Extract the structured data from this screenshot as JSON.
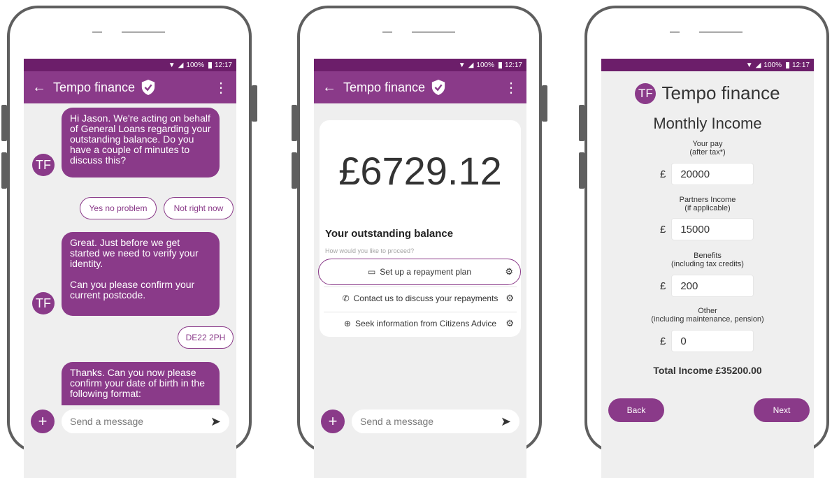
{
  "status": {
    "battery": "100%",
    "time": "12:17"
  },
  "phone1": {
    "app_title": "Tempo finance",
    "avatar_initials": "TF",
    "messages": [
      "Hi Jason. We're acting on behalf of General Loans regarding your outstanding balance. Do you have a couple of minutes to discuss this?",
      "Great. Just before we get started we need to verify your identity.\n\nCan you please confirm your current postcode.",
      "Thanks. Can you now please confirm your date of birth in the following format:"
    ],
    "quick_replies": [
      "Yes no problem",
      "Not right now"
    ],
    "user_reply": "DE22 2PH",
    "composer_placeholder": "Send a message"
  },
  "phone2": {
    "app_title": "Tempo finance",
    "amount": "£6729.12",
    "balance_label": "Your outstanding balance",
    "proceed_prompt": "How would you like to proceed?",
    "options": [
      {
        "label": "Set up a repayment plan",
        "icon": "card-icon"
      },
      {
        "label": "Contact us to discuss your repayments",
        "icon": "phone-icon"
      },
      {
        "label": "Seek information from Citizens Advice",
        "icon": "globe-icon"
      }
    ],
    "composer_placeholder": "Send a message"
  },
  "phone3": {
    "logo_initials": "TF",
    "brand": "Tempo finance",
    "form_title": "Monthly Income",
    "currency": "£",
    "fields": [
      {
        "label": "Your pay",
        "sublabel": "(after tax*)",
        "value": "20000"
      },
      {
        "label": "Partners Income",
        "sublabel": "(if applicable)",
        "value": "15000"
      },
      {
        "label": "Benefits",
        "sublabel": "(including tax credits)",
        "value": "200"
      },
      {
        "label": "Other",
        "sublabel": "(including maintenance, pension)",
        "value": "0"
      }
    ],
    "total": "Total Income £35200.00",
    "back_label": "Back",
    "next_label": "Next"
  },
  "colors": {
    "purple": "#8a3a89",
    "status_purple": "#6c1e6a"
  }
}
